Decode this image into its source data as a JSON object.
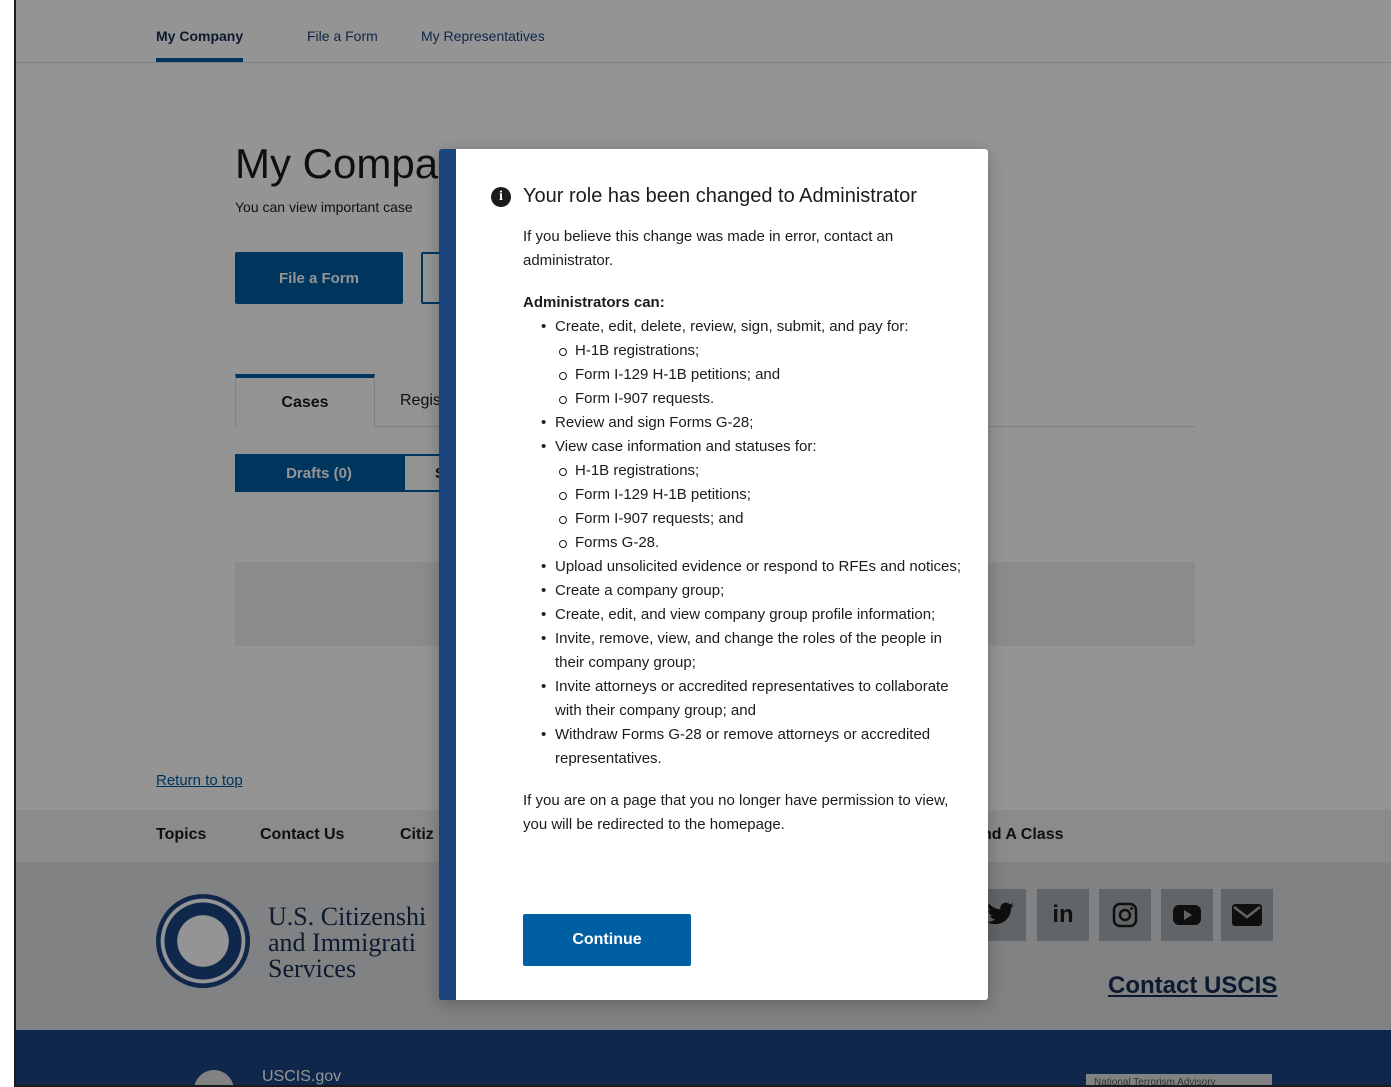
{
  "topnav": {
    "items": [
      {
        "label": "My Company",
        "active": true
      },
      {
        "label": "File a Form",
        "active": false
      },
      {
        "label": "My Representatives",
        "active": false
      }
    ]
  },
  "page": {
    "title": "My Company",
    "subtitle": "You can view important case",
    "file_form_button": "File a Form"
  },
  "tabs": {
    "cases": "Cases",
    "registrations": "Regis"
  },
  "segment": {
    "drafts": "Drafts (0)",
    "second": "S"
  },
  "footer": {
    "return_to_top": "Return to top",
    "nav": [
      "Topics",
      "Contact Us",
      "Citiz",
      "nd A Class"
    ],
    "agency_line1": "U.S. Citizenshi",
    "agency_line2": "and Immigrati",
    "agency_line3": "Services",
    "social_icons": [
      "twitter-icon",
      "linkedin-icon",
      "instagram-icon",
      "youtube-icon",
      "email-icon"
    ],
    "contact_uscis": "Contact USCIS",
    "uscis_gov": "USCIS.gov",
    "ntas": "National Terrorism Advisory"
  },
  "modal": {
    "title": "Your role has been changed to Administrator",
    "lead": "If you believe this change was made in error, contact an administrator.",
    "heading": "Administrators can:",
    "items": [
      "Create, edit, delete, review, sign, submit, and pay for:",
      "Review and sign Forms G-28;",
      "View case information and statuses for:",
      "Upload unsolicited evidence or respond to RFEs and notices;",
      "Create a company group;",
      "Create, edit, and view company group profile information;",
      "Invite, remove, view, and change the roles of the people in their company group;",
      "Invite attorneys or accredited representatives to collaborate with their company group; and",
      "Withdraw Forms G-28 or remove attorneys or accredited representatives."
    ],
    "sub_items_1": [
      "H-1B registrations;",
      "Form I-129 H-1B petitions; and",
      "Form I-907 requests."
    ],
    "sub_items_3": [
      "H-1B registrations;",
      "Form I-129 H-1B petitions;",
      "Form I-907 requests; and",
      "Forms G-28."
    ],
    "closing": "If you are on a page that you no longer have permission to view, you will be redirected to the homepage.",
    "continue_label": "Continue"
  }
}
